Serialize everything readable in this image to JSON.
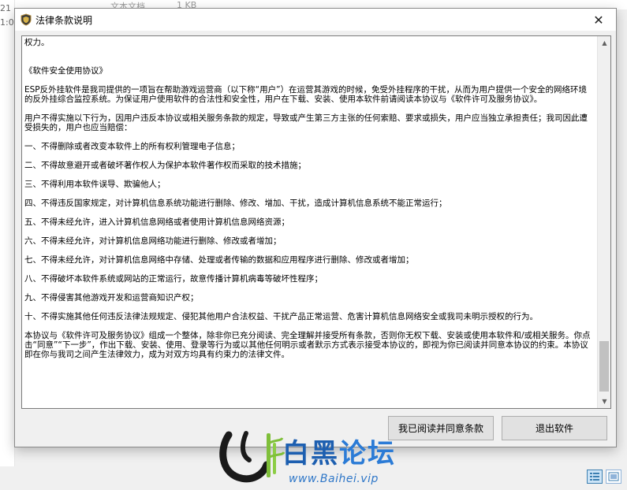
{
  "background": {
    "left_fragments": [
      "21",
      "1:0"
    ],
    "top_fragments": [
      "文本文档",
      "1 KB"
    ]
  },
  "dialog": {
    "title": "法律条款说明",
    "close_symbol": "✕",
    "content": {
      "lines": [
        {
          "gap": 0,
          "text": "权力。"
        },
        {
          "gap": 2,
          "text": "《软件安全使用协议》"
        },
        {
          "gap": 1,
          "text": "ESP反外挂软件是我司提供的一项旨在帮助游戏运营商（以下称“用户”）在运营其游戏的时候，免受外挂程序的干扰，从而为用户提供一个安全的网络环境的反外挂综合监控系统。为保证用户使用软件的合法性和安全性，用户在下载、安装、使用本软件前请阅读本协议与《软件许可及服务协议》。"
        },
        {
          "gap": 1,
          "text": "用户不得实施以下行为，因用户违反本协议或相关服务条款的规定，导致或产生第三方主张的任何索赔、要求或损失，用户应当独立承担责任；我司因此遭受损失的，用户也应当赔偿："
        },
        {
          "gap": 1,
          "text": "一、不得删除或者改变本软件上的所有权利管理电子信息；"
        },
        {
          "gap": 1,
          "text": "二、不得故意避开或者破坏著作权人为保护本软件著作权而采取的技术措施；"
        },
        {
          "gap": 1,
          "text": "三、不得利用本软件误导、欺骗他人；"
        },
        {
          "gap": 1,
          "text": "四、不得违反国家规定，对计算机信息系统功能进行删除、修改、增加、干扰，造成计算机信息系统不能正常运行；"
        },
        {
          "gap": 1,
          "text": "五、不得未经允许，进入计算机信息网络或者使用计算机信息网络资源；"
        },
        {
          "gap": 1,
          "text": "六、不得未经允许，对计算机信息网络功能进行删除、修改或者增加；"
        },
        {
          "gap": 1,
          "text": "七、不得未经允许，对计算机信息网络中存储、处理或者传输的数据和应用程序进行删除、修改或者增加；"
        },
        {
          "gap": 1,
          "text": "八、不得破坏本软件系统或网站的正常运行，故意传播计算机病毒等破坏性程序；"
        },
        {
          "gap": 1,
          "text": "九、不得侵害其他游戏开发和运营商知识产权；"
        },
        {
          "gap": 1,
          "text": "十、不得实施其他任何违反法律法规规定、侵犯其他用户合法权益、干扰产品正常运营、危害计算机信息网络安全或我司未明示授权的行为。"
        },
        {
          "gap": 1,
          "text": "本协议与《软件许可及服务协议》组成一个整体，除非你已充分阅读、完全理解并接受所有条款，否则你无权下载、安装或使用本软件和/或相关服务。你点击“同意”“下一步”，作出下载、安装、使用、登录等行为或以其他任何明示或者默示方式表示接受本协议的，即视为你已阅读并同意本协议的约束。本协议即在你与我司之间产生法律效力，成为对双方均具有约束力的法律文件。"
        }
      ]
    },
    "buttons": {
      "agree": "我已阅读并同意条款",
      "exit": "退出软件"
    }
  },
  "watermark": {
    "chars": [
      "白",
      "黑",
      "论",
      "坛"
    ],
    "site": "www.Baihei.vip"
  },
  "colors": {
    "watermark_blue": "#1d5fb0",
    "watermark_light_blue": "#2b7bd6",
    "watermark_green": "#7fbf3a"
  }
}
